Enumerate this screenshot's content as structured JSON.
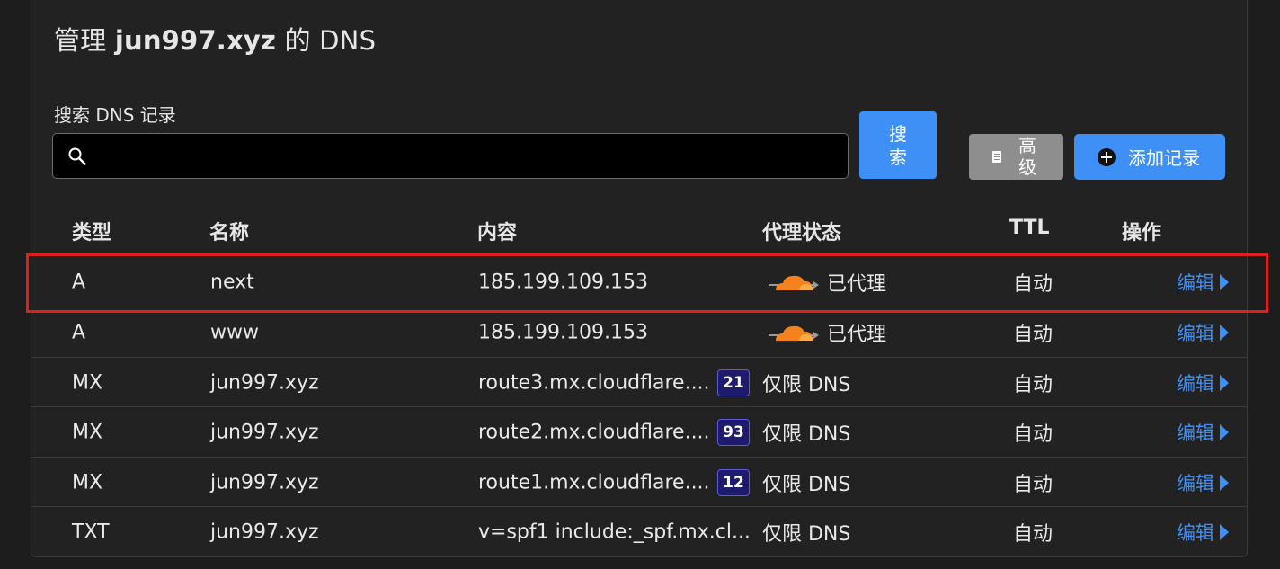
{
  "header": {
    "title_prefix": "管理 ",
    "title_domain": "jun997.xyz",
    "title_suffix": " 的 DNS"
  },
  "search": {
    "label": "搜索 DNS 记录",
    "value": "",
    "placeholder": "",
    "button_label": "搜索"
  },
  "toolbar": {
    "advanced_label": "高级",
    "add_record_label": "添加记录"
  },
  "table": {
    "columns": [
      "类型",
      "名称",
      "内容",
      "代理状态",
      "TTL",
      "操作"
    ],
    "rows": [
      {
        "type": "A",
        "name": "next",
        "content": "185.199.109.153",
        "badge": "",
        "proxy": "已代理",
        "proxied": true,
        "ttl": "自动",
        "action": "编辑",
        "highlighted": true
      },
      {
        "type": "A",
        "name": "www",
        "content": "185.199.109.153",
        "badge": "",
        "proxy": "已代理",
        "proxied": true,
        "ttl": "自动",
        "action": "编辑",
        "highlighted": false
      },
      {
        "type": "MX",
        "name": "jun997.xyz",
        "content": "route3.mx.cloudflare....",
        "badge": "21",
        "proxy": "仅限 DNS",
        "proxied": false,
        "ttl": "自动",
        "action": "编辑",
        "highlighted": false
      },
      {
        "type": "MX",
        "name": "jun997.xyz",
        "content": "route2.mx.cloudflare....",
        "badge": "93",
        "proxy": "仅限 DNS",
        "proxied": false,
        "ttl": "自动",
        "action": "编辑",
        "highlighted": false
      },
      {
        "type": "MX",
        "name": "jun997.xyz",
        "content": "route1.mx.cloudflare....",
        "badge": "12",
        "proxy": "仅限 DNS",
        "proxied": false,
        "ttl": "自动",
        "action": "编辑",
        "highlighted": false
      },
      {
        "type": "TXT",
        "name": "jun997.xyz",
        "content": "v=spf1 include:_spf.mx.cl...",
        "badge": "",
        "proxy": "仅限 DNS",
        "proxied": false,
        "ttl": "自动",
        "action": "编辑",
        "highlighted": false
      }
    ]
  },
  "icons": {
    "search": "search-icon",
    "advanced": "document-icon",
    "add": "plus-circle-icon",
    "proxied": "cloudflare-cloud-icon",
    "edit_arrow": "caret-right-icon"
  },
  "colors": {
    "accent": "#3f90f6",
    "highlight": "#e0201c",
    "cloud": "#f6821f",
    "badge_bg": "#1e1b6b"
  }
}
